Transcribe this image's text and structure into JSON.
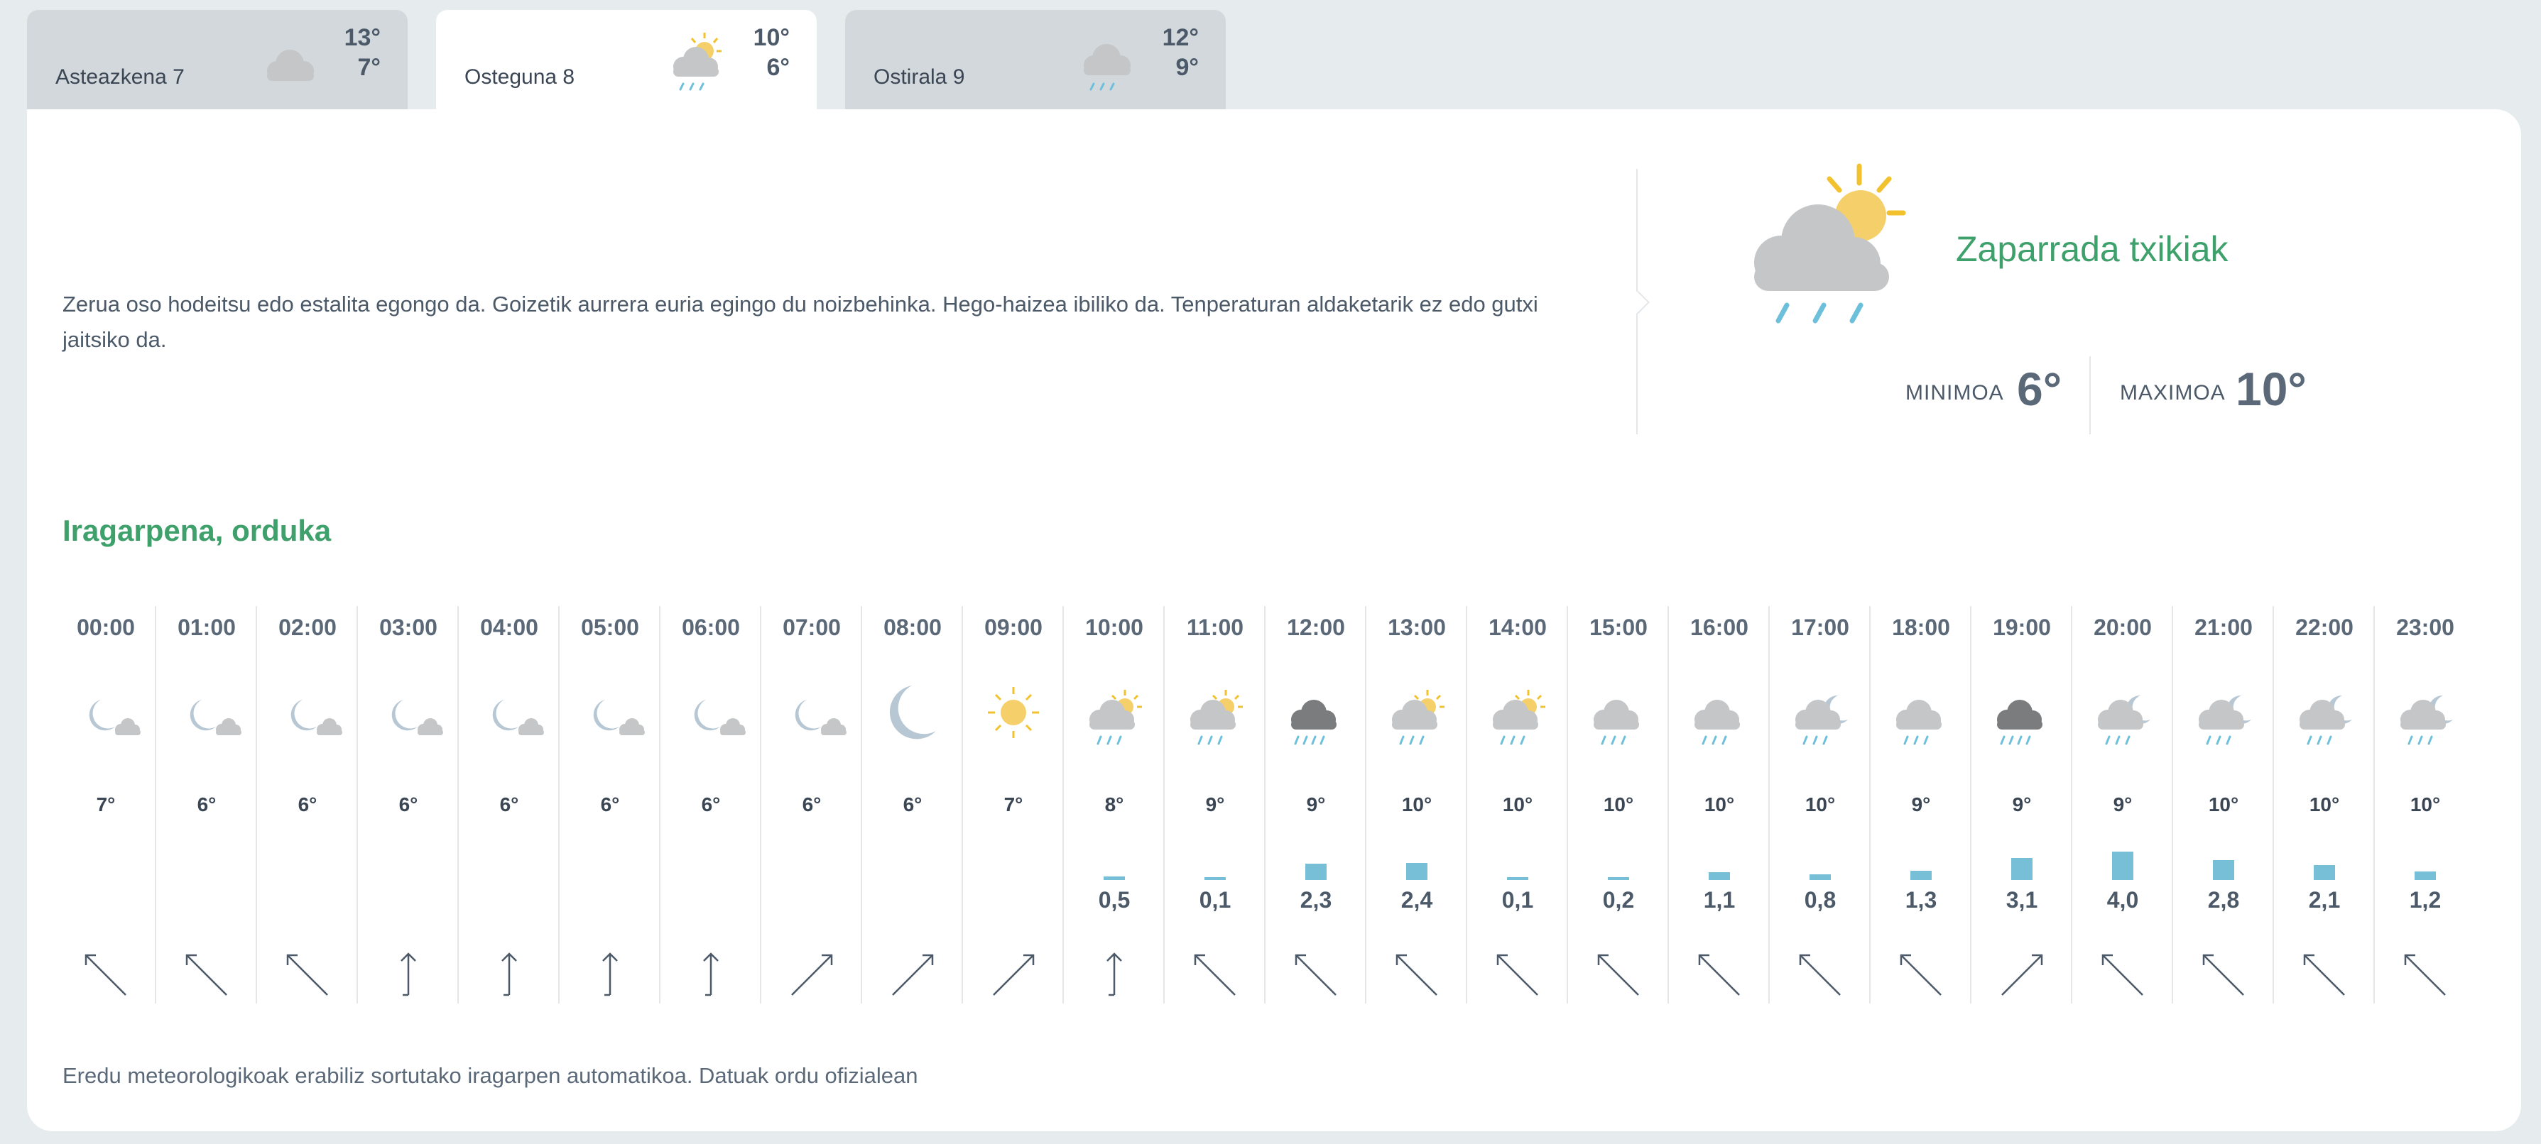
{
  "tabs": [
    {
      "name": "Asteazkena 7",
      "high": "13°",
      "low": "7°",
      "icon": "cloud-icon",
      "active": false
    },
    {
      "name": "Osteguna 8",
      "high": "10°",
      "low": "6°",
      "icon": "sun-cloud-rain-icon",
      "active": true
    },
    {
      "name": "Ostirala 9",
      "high": "12°",
      "low": "9°",
      "icon": "cloud-rain-icon",
      "active": false
    }
  ],
  "summary": {
    "text": "Zerua oso hodeitsu edo estalita egongo da. Goizetik aurrera euria egingo du noizbehinka. Hego-haizea ibiliko da. Tenperaturan aldaketarik ez edo gutxi jaitsiko da."
  },
  "condition": {
    "label": "Zaparrada txikiak",
    "icon": "sun-cloud-rain-icon",
    "min_label": "MINIMOA",
    "min_value": "6°",
    "max_label": "MAXIMOA",
    "max_value": "10°"
  },
  "hourly_title": "Iragarpena, orduka",
  "hours": [
    {
      "time": "00:00",
      "icon": "moon-cloud",
      "temp": "7°",
      "precip": "",
      "wind": "nw"
    },
    {
      "time": "01:00",
      "icon": "moon-cloud",
      "temp": "6°",
      "precip": "",
      "wind": "nw"
    },
    {
      "time": "02:00",
      "icon": "moon-cloud",
      "temp": "6°",
      "precip": "",
      "wind": "nw"
    },
    {
      "time": "03:00",
      "icon": "moon-cloud",
      "temp": "6°",
      "precip": "",
      "wind": "n"
    },
    {
      "time": "04:00",
      "icon": "moon-cloud",
      "temp": "6°",
      "precip": "",
      "wind": "n"
    },
    {
      "time": "05:00",
      "icon": "moon-cloud",
      "temp": "6°",
      "precip": "",
      "wind": "n"
    },
    {
      "time": "06:00",
      "icon": "moon-cloud",
      "temp": "6°",
      "precip": "",
      "wind": "n"
    },
    {
      "time": "07:00",
      "icon": "moon-cloud",
      "temp": "6°",
      "precip": "",
      "wind": "ne"
    },
    {
      "time": "08:00",
      "icon": "moon",
      "temp": "6°",
      "precip": "",
      "wind": "ne"
    },
    {
      "time": "09:00",
      "icon": "sun",
      "temp": "7°",
      "precip": "",
      "wind": "ne"
    },
    {
      "time": "10:00",
      "icon": "sun-cloud-rain",
      "temp": "8°",
      "precip": "0,5",
      "wind": "n"
    },
    {
      "time": "11:00",
      "icon": "sun-cloud-rain",
      "temp": "9°",
      "precip": "0,1",
      "wind": "nw"
    },
    {
      "time": "12:00",
      "icon": "dark-cloud-heavy-rain",
      "temp": "9°",
      "precip": "2,3",
      "wind": "nw"
    },
    {
      "time": "13:00",
      "icon": "sun-cloud-rain",
      "temp": "10°",
      "precip": "2,4",
      "wind": "nw"
    },
    {
      "time": "14:00",
      "icon": "sun-cloud-rain",
      "temp": "10°",
      "precip": "0,1",
      "wind": "nw"
    },
    {
      "time": "15:00",
      "icon": "cloud-rain",
      "temp": "10°",
      "precip": "0,2",
      "wind": "nw"
    },
    {
      "time": "16:00",
      "icon": "cloud-rain",
      "temp": "10°",
      "precip": "1,1",
      "wind": "nw"
    },
    {
      "time": "17:00",
      "icon": "moon-cloud-rain",
      "temp": "10°",
      "precip": "0,8",
      "wind": "nw"
    },
    {
      "time": "18:00",
      "icon": "cloud-rain",
      "temp": "9°",
      "precip": "1,3",
      "wind": "nw"
    },
    {
      "time": "19:00",
      "icon": "dark-cloud-heavy-rain",
      "temp": "9°",
      "precip": "3,1",
      "wind": "ne"
    },
    {
      "time": "20:00",
      "icon": "moon-cloud-rain",
      "temp": "9°",
      "precip": "4,0",
      "wind": "nw"
    },
    {
      "time": "21:00",
      "icon": "moon-cloud-rain",
      "temp": "10°",
      "precip": "2,8",
      "wind": "nw"
    },
    {
      "time": "22:00",
      "icon": "moon-cloud-rain",
      "temp": "10°",
      "precip": "2,1",
      "wind": "nw"
    },
    {
      "time": "23:00",
      "icon": "moon-cloud-rain",
      "temp": "10°",
      "precip": "1,2",
      "wind": "nw"
    }
  ],
  "footer": "Eredu meteorologikoak erabiliz sortutako iragarpen automatikoa. Datuak ordu ofizialean"
}
